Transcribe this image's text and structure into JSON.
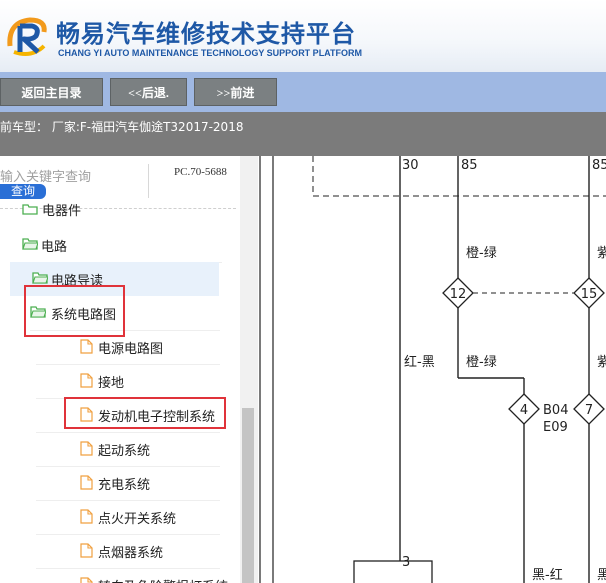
{
  "header": {
    "title": "畅易汽车维修技术支持平台",
    "subtitle": "CHANG YI AUTO MAINTENANCE TECHNOLOGY SUPPORT PLATFORM"
  },
  "nav": {
    "home_label": "返回主目录",
    "back_label": "<<后退.",
    "forward_label": ">>前进"
  },
  "info": {
    "text": "前车型：  厂家:F-福田汽车伽途T32017-2018"
  },
  "search": {
    "placeholder": "输入关键字查询",
    "button_label": "查询",
    "pc_code": "PC.70-5688"
  },
  "tree": {
    "partial_label": "电器件",
    "circuit_label": "电路",
    "guide_label": "电路导读",
    "diagram_label": "系统电路图",
    "children": [
      "电源电路图",
      "接地",
      "发动机电子控制系统",
      "起动系统",
      "充电系统",
      "点火开关系统",
      "点烟器系统",
      "转向及危险警报灯系统"
    ]
  },
  "diagram": {
    "pin_30": "30",
    "pin_85_a": "85",
    "pin_85_b": "85",
    "wire_orange_green_top": "橙-绿",
    "wire_purple_top": "紫",
    "wire_red_black": "红-黑",
    "wire_orange_green_mid": "橙-绿",
    "wire_purple_mid": "紫",
    "connector_12": "12",
    "connector_15": "15",
    "connector_4": "4",
    "connector_7": "7",
    "ref_b04": "B04",
    "ref_e09": "E09",
    "pin_3": "3",
    "wire_black_red": "黑-红",
    "wire_black": "黑"
  },
  "colors": {
    "brand_blue": "#1e58a6",
    "nav_bar": "#9fb8e3",
    "nav_button": "#7b8082",
    "info_bar": "#7b7b7b",
    "search_button": "#2a6fd6",
    "highlight_red": "#e0333a",
    "selected_row": "#e8f1fb"
  },
  "icons": {
    "logo": "logo-icon",
    "folder": "folder-icon",
    "document": "document-icon"
  }
}
